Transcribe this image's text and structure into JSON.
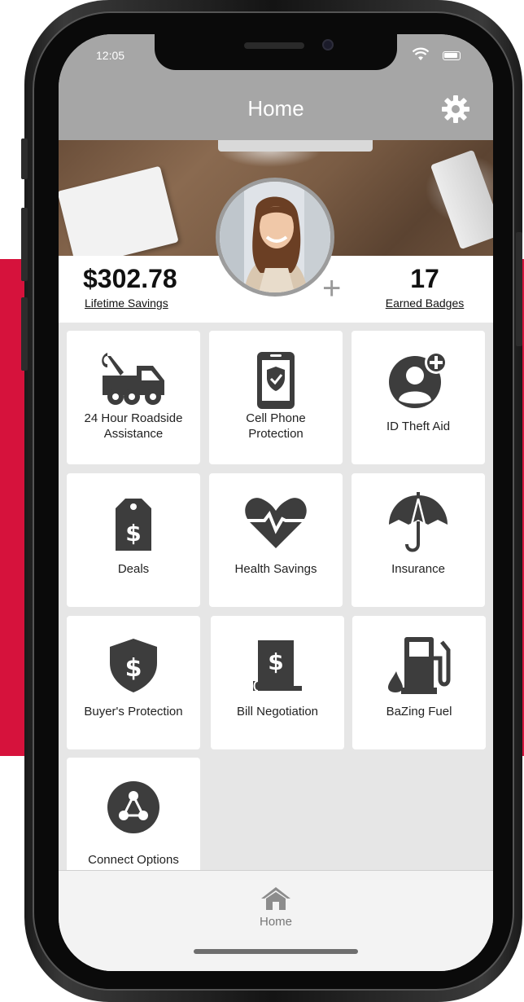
{
  "status_bar": {
    "time": "12:05"
  },
  "header": {
    "title": "Home"
  },
  "stats": {
    "lifetime_savings_value": "$302.78",
    "lifetime_savings_label": "Lifetime Savings",
    "badges_value": "17",
    "badges_label": "Earned Badges"
  },
  "tiles": [
    {
      "label_line1": "24 Hour Roadside",
      "label_line2": "Assistance",
      "icon": "tow-truck-icon"
    },
    {
      "label_line1": "Cell Phone",
      "label_line2": "Protection",
      "icon": "phone-shield-icon"
    },
    {
      "label_line1": "ID Theft Aid",
      "label_line2": "",
      "icon": "user-plus-icon"
    },
    {
      "label_line1": "Deals",
      "label_line2": "",
      "icon": "price-tag-icon"
    },
    {
      "label_line1": "Health Savings",
      "label_line2": "",
      "icon": "heartbeat-icon"
    },
    {
      "label_line1": "Insurance",
      "label_line2": "",
      "icon": "umbrella-icon"
    },
    {
      "label_line1": "Buyer's Protection",
      "label_line2": "",
      "icon": "shield-dollar-icon"
    },
    {
      "label_line1": "Bill Negotiation",
      "label_line2": "",
      "icon": "bill-icon"
    },
    {
      "label_line1": "BaZing Fuel",
      "label_line2": "",
      "icon": "fuel-pump-icon"
    },
    {
      "label_line1": "Connect Options",
      "label_line2": "",
      "icon": "network-icon"
    }
  ],
  "tabbar": {
    "home_label": "Home"
  },
  "colors": {
    "accent_red": "#d6123c",
    "header_gray": "#a6a6a6",
    "icon_dark": "#3d3d3d"
  }
}
